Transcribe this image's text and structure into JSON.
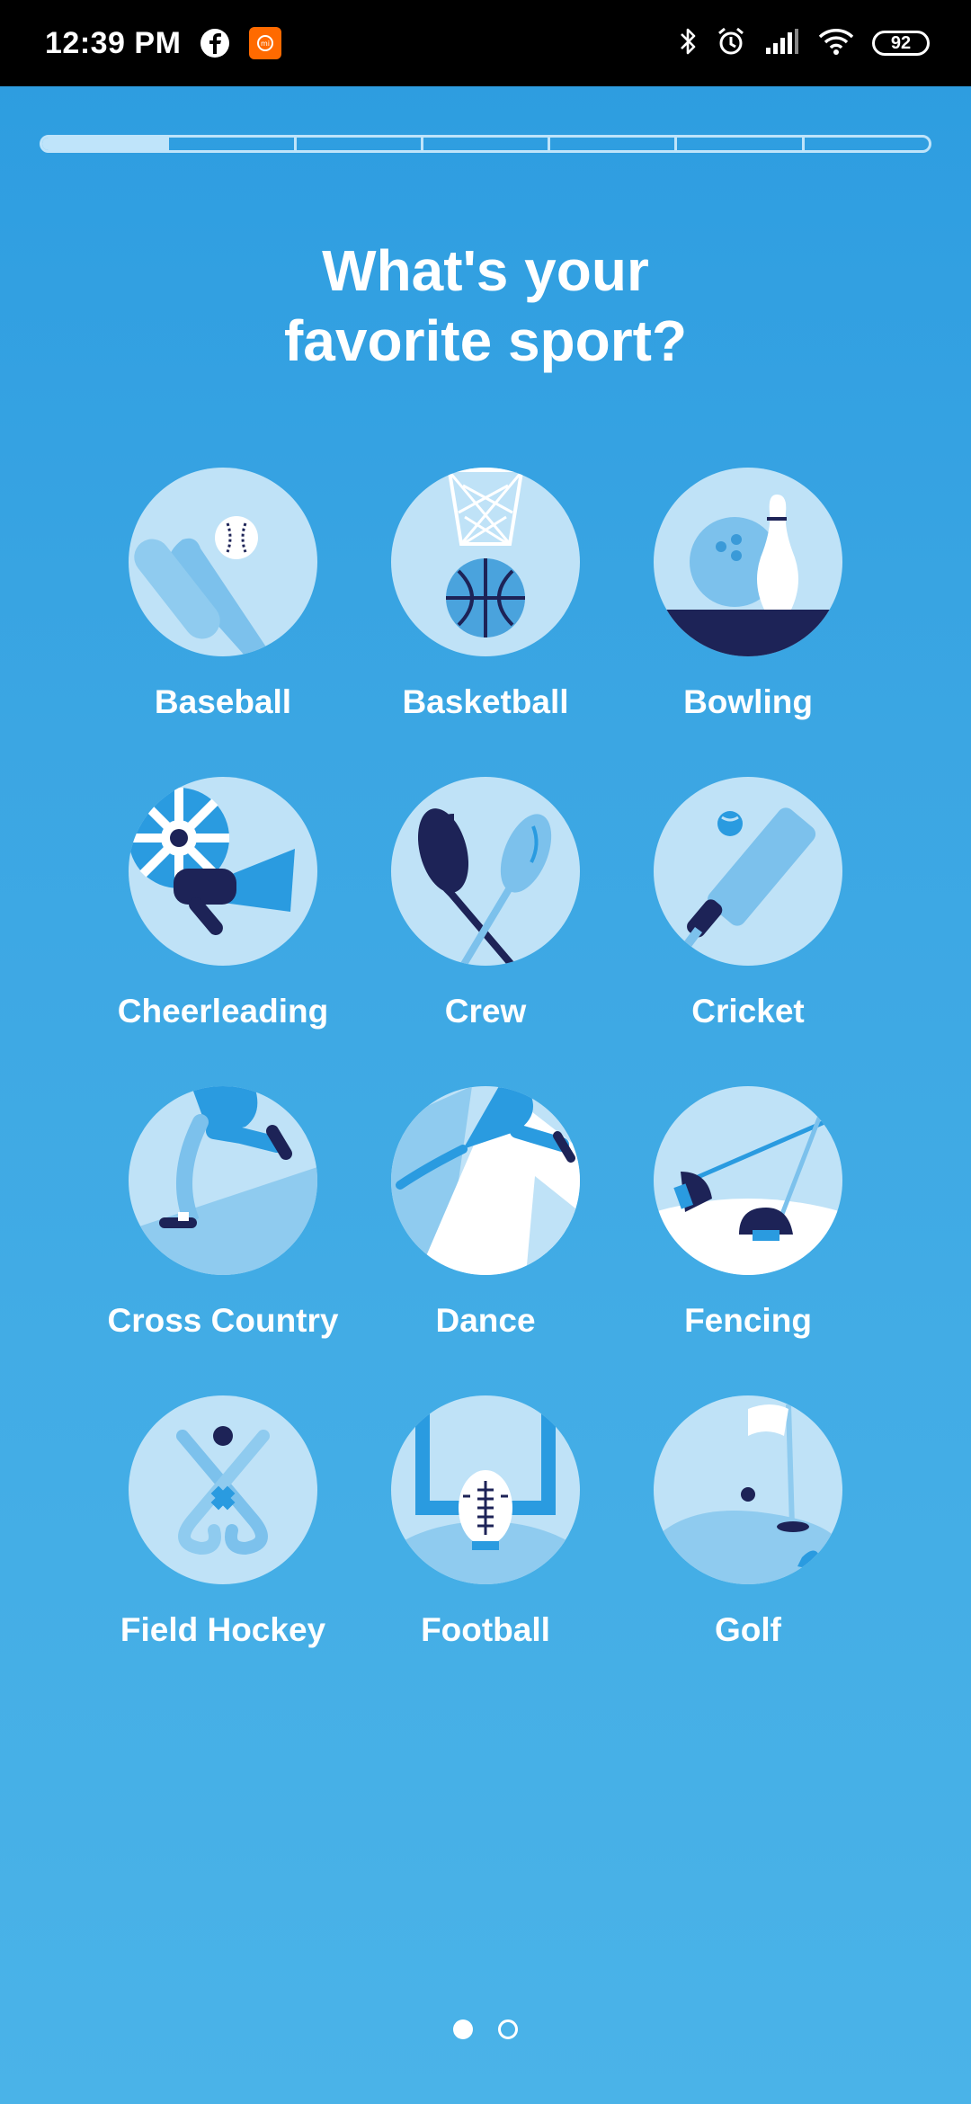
{
  "status_bar": {
    "time": "12:39 PM",
    "battery": "92",
    "icons": [
      "facebook-icon",
      "mi-app-icon",
      "bluetooth-icon",
      "alarm-icon",
      "signal-icon",
      "wifi-icon",
      "battery-icon"
    ]
  },
  "progress": {
    "total_steps": 7,
    "completed_steps": 1
  },
  "title_line1": "What's your",
  "title_line2": "favorite sport?",
  "sports": [
    {
      "label": "Baseball"
    },
    {
      "label": "Basketball"
    },
    {
      "label": "Bowling"
    },
    {
      "label": "Cheerleading"
    },
    {
      "label": "Crew"
    },
    {
      "label": "Cricket"
    },
    {
      "label": "Cross Country"
    },
    {
      "label": "Dance"
    },
    {
      "label": "Fencing"
    },
    {
      "label": "Field Hockey"
    },
    {
      "label": "Football"
    },
    {
      "label": "Golf"
    }
  ],
  "pagination": {
    "pages": 2,
    "current": 1
  },
  "colors": {
    "background_top": "#2c9ce0",
    "background_bottom": "#4ab3e8",
    "circle": "#bfe2f7",
    "navy": "#1d2357",
    "accent_blue": "#2a9be0"
  }
}
